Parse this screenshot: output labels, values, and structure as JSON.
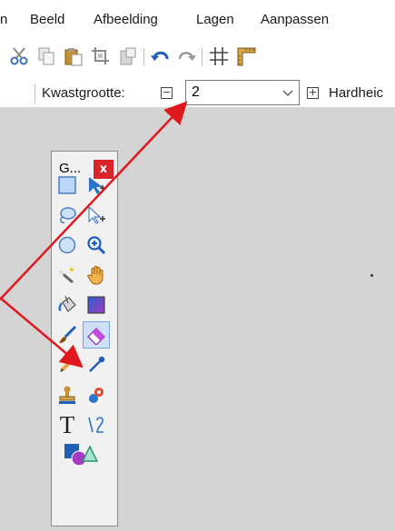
{
  "menu": {
    "items": [
      "n",
      "Beeld",
      "Afbeelding",
      "Lagen",
      "Aanpassen"
    ]
  },
  "toolbar": {
    "icons": [
      "cut-icon",
      "copy-icon",
      "paste-icon",
      "crop-icon",
      "paste-new-icon",
      "undo-icon",
      "redo-icon",
      "grid-icon",
      "ruler-icon"
    ]
  },
  "options": {
    "brush_size_label": "Kwastgrootte:",
    "brush_size_value": "2",
    "minus_glyph": "−",
    "plus_glyph": "+",
    "hardness_label": "Hardheic"
  },
  "tools_window": {
    "title": "G...",
    "close": "x",
    "tools": [
      "rectangle-select",
      "move-selection",
      "lasso-select",
      "move-selected",
      "ellipse-select",
      "zoom",
      "magic-wand",
      "pan",
      "paint-bucket",
      "gradient",
      "paintbrush",
      "eraser",
      "pencil",
      "color-picker",
      "clone-stamp",
      "recolor",
      "text",
      "line-curve",
      "shapes"
    ],
    "active_tool": "eraser",
    "text_tool_glyph": "T"
  },
  "colors": {
    "accent": "#2b74c8",
    "close_red": "#d9242b",
    "arrow_red": "#e0191f",
    "canvas_gray": "#d4d4d4"
  }
}
